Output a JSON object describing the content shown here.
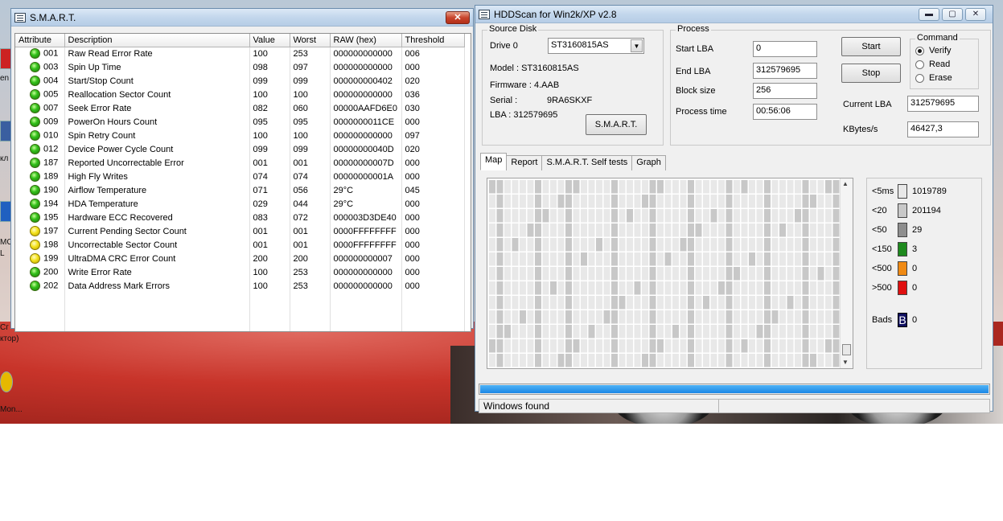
{
  "desktop": {
    "left_labels": [
      "кл",
      "en",
      "МС",
      "L",
      "Сг",
      "ктор)",
      "Mon..."
    ]
  },
  "smart_window": {
    "title": "S.M.A.R.T.",
    "close_glyph": "✕",
    "columns": [
      "Attribute",
      "Description",
      "Value",
      "Worst",
      "RAW (hex)",
      "Threshold"
    ],
    "rows": [
      {
        "status": "ok",
        "id": "001",
        "desc": "Raw Read Error Rate",
        "value": "100",
        "worst": "253",
        "raw": "000000000000",
        "threshold": "006"
      },
      {
        "status": "ok",
        "id": "003",
        "desc": "Spin Up Time",
        "value": "098",
        "worst": "097",
        "raw": "000000000000",
        "threshold": "000"
      },
      {
        "status": "ok",
        "id": "004",
        "desc": "Start/Stop Count",
        "value": "099",
        "worst": "099",
        "raw": "000000000402",
        "threshold": "020"
      },
      {
        "status": "ok",
        "id": "005",
        "desc": "Reallocation Sector Count",
        "value": "100",
        "worst": "100",
        "raw": "000000000000",
        "threshold": "036"
      },
      {
        "status": "ok",
        "id": "007",
        "desc": "Seek Error Rate",
        "value": "082",
        "worst": "060",
        "raw": "00000AAFD6E0",
        "threshold": "030"
      },
      {
        "status": "ok",
        "id": "009",
        "desc": "PowerOn Hours Count",
        "value": "095",
        "worst": "095",
        "raw": "0000000011CE",
        "threshold": "000"
      },
      {
        "status": "ok",
        "id": "010",
        "desc": "Spin Retry Count",
        "value": "100",
        "worst": "100",
        "raw": "000000000000",
        "threshold": "097"
      },
      {
        "status": "ok",
        "id": "012",
        "desc": "Device Power Cycle Count",
        "value": "099",
        "worst": "099",
        "raw": "00000000040D",
        "threshold": "020"
      },
      {
        "status": "ok",
        "id": "187",
        "desc": "Reported Uncorrectable Error",
        "value": "001",
        "worst": "001",
        "raw": "00000000007D",
        "threshold": "000"
      },
      {
        "status": "ok",
        "id": "189",
        "desc": "High Fly Writes",
        "value": "074",
        "worst": "074",
        "raw": "00000000001A",
        "threshold": "000"
      },
      {
        "status": "ok",
        "id": "190",
        "desc": "Airflow Temperature",
        "value": "071",
        "worst": "056",
        "raw": "29°C",
        "threshold": "045"
      },
      {
        "status": "ok",
        "id": "194",
        "desc": "HDA Temperature",
        "value": "029",
        "worst": "044",
        "raw": "29°C",
        "threshold": "000"
      },
      {
        "status": "ok",
        "id": "195",
        "desc": "Hardware ECC Recovered",
        "value": "083",
        "worst": "072",
        "raw": "000003D3DE40",
        "threshold": "000"
      },
      {
        "status": "warn",
        "id": "197",
        "desc": "Current Pending Sector Count",
        "value": "001",
        "worst": "001",
        "raw": "0000FFFFFFFF",
        "threshold": "000"
      },
      {
        "status": "warn",
        "id": "198",
        "desc": "Uncorrectable Sector Count",
        "value": "001",
        "worst": "001",
        "raw": "0000FFFFFFFF",
        "threshold": "000"
      },
      {
        "status": "warn",
        "id": "199",
        "desc": "UltraDMA CRC Error Count",
        "value": "200",
        "worst": "200",
        "raw": "000000000007",
        "threshold": "000"
      },
      {
        "status": "ok",
        "id": "200",
        "desc": "Write Error Rate",
        "value": "100",
        "worst": "253",
        "raw": "000000000000",
        "threshold": "000"
      },
      {
        "status": "ok",
        "id": "202",
        "desc": "Data Address Mark Errors",
        "value": "100",
        "worst": "253",
        "raw": "000000000000",
        "threshold": "000"
      }
    ]
  },
  "hddscan": {
    "title": "HDDScan for Win2k/XP  v2.8",
    "controls": {
      "minimize": "▬",
      "maximize": "▢",
      "close": "✕"
    },
    "source_disk": {
      "group_title": "Source Disk",
      "drive_label": "Drive  0",
      "drive_value": "ST3160815AS",
      "model": "Model : ST3160815AS",
      "firmware": "Firmware : 4.AAB",
      "serial_label": "Serial :",
      "serial_value": "9RA6SKXF",
      "lba": "LBA :   312579695",
      "smart_button": "S.M.A.R.T."
    },
    "process": {
      "group_title": "Process",
      "start_lba_label": "Start LBA",
      "start_lba": "0",
      "end_lba_label": "End LBA",
      "end_lba": "312579695",
      "block_size_label": "Block size",
      "block_size": "256",
      "process_time_label": "Process time",
      "process_time": "00:56:06",
      "start_button": "Start",
      "stop_button": "Stop",
      "command_title": "Command",
      "commands": [
        {
          "label": "Verify",
          "selected": true
        },
        {
          "label": "Read",
          "selected": false
        },
        {
          "label": "Erase",
          "selected": false
        }
      ],
      "current_lba_label": "Current LBA",
      "current_lba": "312579695",
      "kbytes_label": "KBytes/s",
      "kbytes": "46427,3"
    },
    "tabs": [
      "Map",
      "Report",
      "S.M.A.R.T. Self tests",
      "Graph"
    ],
    "active_tab": "Map",
    "legend": [
      {
        "label": "<5ms",
        "count": "1019789",
        "color": "#e8e8e8"
      },
      {
        "label": "<20",
        "count": "201194",
        "color": "#c8c8c8"
      },
      {
        "label": "<50",
        "count": "29",
        "color": "#8e8e8e"
      },
      {
        "label": "<150",
        "count": "3",
        "color": "#1e8a1e"
      },
      {
        "label": "<500",
        "count": "0",
        "color": "#f08a14"
      },
      {
        "label": ">500",
        "count": "0",
        "color": "#e01010"
      }
    ],
    "bads": {
      "label": "Bads",
      "glyph": "B",
      "count": "0",
      "color": "#101060"
    },
    "progress": 1.0,
    "status_text": "Windows  found"
  }
}
